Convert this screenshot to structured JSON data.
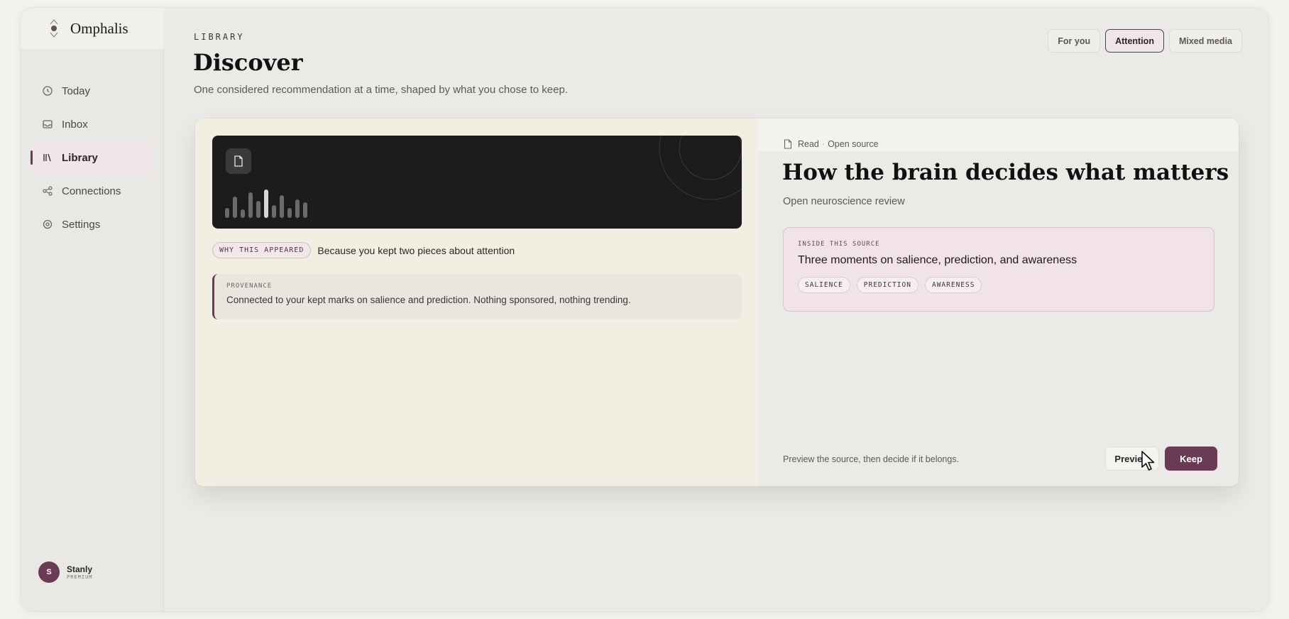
{
  "app": {
    "name": "Omphalis"
  },
  "sidebar": {
    "items": [
      {
        "label": "Today",
        "icon": "clock-icon"
      },
      {
        "label": "Inbox",
        "icon": "inbox-icon"
      },
      {
        "label": "Library",
        "icon": "library-icon",
        "active": true
      },
      {
        "label": "Connections",
        "icon": "share-icon"
      },
      {
        "label": "Settings",
        "icon": "gear-icon"
      }
    ],
    "user": {
      "initial": "S",
      "name": "Stanly",
      "plan": "PREMIUM"
    }
  },
  "header": {
    "eyebrow": "LIBRARY",
    "title": "Discover",
    "subtitle": "One considered recommendation at a time, shaped by what you chose to keep.",
    "filters": [
      "For you",
      "Attention",
      "Mixed media"
    ],
    "active_filter": "Attention"
  },
  "card": {
    "why_badge": "WHY THIS APPEARED",
    "why_text": "Because you kept two pieces about attention",
    "provenance_label": "PROVENANCE",
    "provenance_text": "Connected to your kept marks on salience and prediction. Nothing sponsored, nothing trending.",
    "meta_type": "Read",
    "meta_source": "Open source",
    "title": "How the brain decides what matters",
    "subtitle": "Open neuroscience review",
    "inside_label": "INSIDE THIS SOURCE",
    "inside_text": "Three moments on salience, prediction, and awareness",
    "tags": [
      "SALIENCE",
      "PREDICTION",
      "AWARENESS"
    ],
    "hint": "Preview the source, then decide if it belongs.",
    "preview_label": "Preview",
    "keep_label": "Keep"
  },
  "colors": {
    "accent": "#6b3a55",
    "accent_soft": "#f1e4ea",
    "media_bg": "#1c1b1d",
    "card_left_bg": "#f0efe2"
  }
}
